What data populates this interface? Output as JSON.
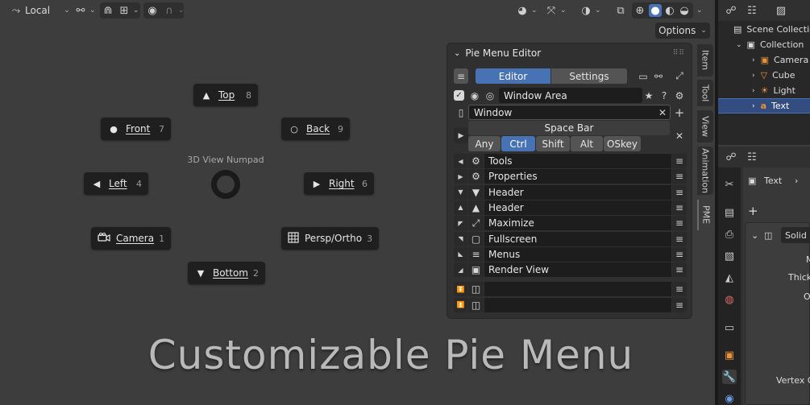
{
  "viewport_header": {
    "pivot_label": "Local",
    "options_label": "Options"
  },
  "pie": {
    "title": "3D View Numpad",
    "items": [
      {
        "label": "Top",
        "num": "8",
        "icon": "triangle-up-icon",
        "glyph": "▲"
      },
      {
        "label": "Front",
        "num": "7",
        "icon": "circle-filled-icon",
        "glyph": "●"
      },
      {
        "label": "Back",
        "num": "9",
        "icon": "circle-outline-icon",
        "glyph": "○"
      },
      {
        "label": "Left",
        "num": "4",
        "icon": "triangle-left-icon",
        "glyph": "◀"
      },
      {
        "label": "Right",
        "num": "6",
        "icon": "triangle-right-icon",
        "glyph": "▶"
      },
      {
        "label": "Camera",
        "num": "1",
        "icon": "camera-icon",
        "glyph": "⌨"
      },
      {
        "label": "Persp/Ortho",
        "num": "3",
        "icon": "grid-icon",
        "glyph": "▦"
      },
      {
        "label": "Bottom",
        "num": "2",
        "icon": "triangle-down-icon",
        "glyph": "▼"
      }
    ]
  },
  "caption": "Customizable Pie Menu",
  "pme": {
    "title": "Pie Menu Editor",
    "tabs": [
      "Editor",
      "Settings"
    ],
    "menu_name": "Window Area",
    "subname": "Window",
    "hotkey_title": "Space Bar",
    "modifiers": [
      "Any",
      "Ctrl",
      "Shift",
      "Alt",
      "OSkey"
    ],
    "active_modifier": "Ctrl",
    "items": [
      {
        "label": "Tools",
        "icon": "gear-icon",
        "glyph": "⚙",
        "lead": "◀"
      },
      {
        "label": "Properties",
        "icon": "gears-icon",
        "glyph": "⚙",
        "lead": "▶"
      },
      {
        "label": "Header",
        "icon": "triangle-down-icon",
        "glyph": "▼",
        "lead": "▼"
      },
      {
        "label": "Header",
        "icon": "triangle-up-icon",
        "glyph": "▲",
        "lead": "▲"
      },
      {
        "label": "Maximize",
        "icon": "maximize-icon",
        "glyph": "⤢",
        "lead": "◤"
      },
      {
        "label": "Fullscreen",
        "icon": "fullscreen-icon",
        "glyph": "▢",
        "lead": "◥"
      },
      {
        "label": "Menus",
        "icon": "menu-icon",
        "glyph": "≡",
        "lead": "◣"
      },
      {
        "label": "Render View",
        "icon": "image-icon",
        "glyph": "▣",
        "lead": "◢"
      },
      {
        "label": "",
        "icon": "blank-icon",
        "glyph": "◫",
        "lead": "⏬"
      },
      {
        "label": "",
        "icon": "blank-icon",
        "glyph": "◫",
        "lead": "⏫"
      }
    ]
  },
  "side_tabs": [
    "Item",
    "Tool",
    "View",
    "Animation",
    "PME"
  ],
  "outliner": {
    "rows": [
      {
        "label": "Scene Collection",
        "glyph": "▤"
      },
      {
        "label": "Collection",
        "glyph": "▣"
      },
      {
        "label": "Camera",
        "glyph": "📷"
      },
      {
        "label": "Cube",
        "glyph": "▽"
      },
      {
        "label": "Light",
        "glyph": "💡"
      },
      {
        "label": "Text",
        "glyph": "a"
      }
    ]
  },
  "properties": {
    "breadcrumb": "Text",
    "panel_title": "Solid",
    "labels": [
      "M",
      "Thick",
      "O",
      "Vertex G"
    ]
  }
}
